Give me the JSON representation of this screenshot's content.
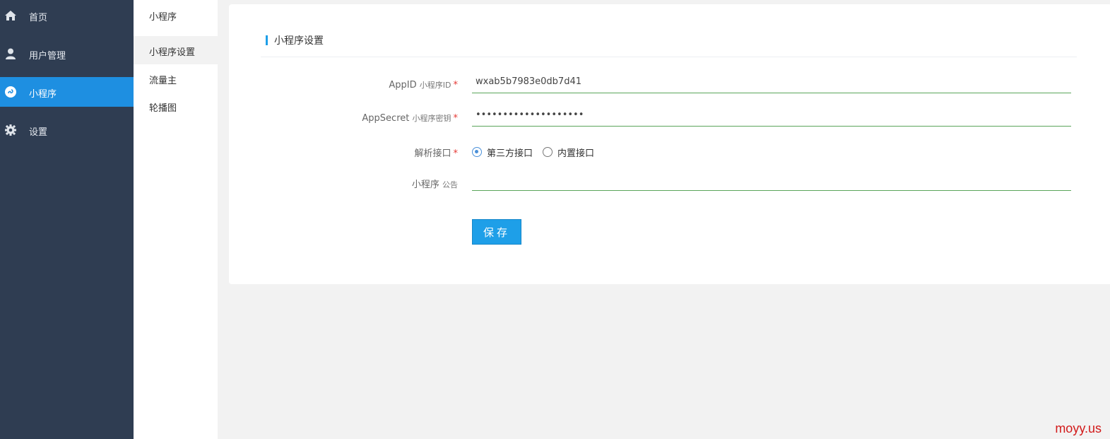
{
  "sidebar": {
    "items": [
      {
        "label": "首页",
        "icon": "home-icon"
      },
      {
        "label": "用户管理",
        "icon": "user-icon"
      },
      {
        "label": "小程序",
        "icon": "miniprogram-icon",
        "active": true
      },
      {
        "label": "设置",
        "icon": "gear-icon"
      }
    ],
    "active_color": "#1e8fe1",
    "background": "#2f3d52"
  },
  "submenu": {
    "title": "小程序",
    "items": [
      {
        "label": "小程序设置",
        "active": true
      },
      {
        "label": "流量主"
      },
      {
        "label": "轮播图"
      }
    ]
  },
  "card": {
    "title": "小程序设置",
    "fields": {
      "appid": {
        "label": "AppID",
        "label_small": "小程序ID",
        "required": "*",
        "value": "wxab5b7983e0db7d41"
      },
      "appsecret": {
        "label": "AppSecret",
        "label_small": "小程序密钥",
        "required": "*",
        "value": "••••••••••••••••••••"
      },
      "api": {
        "label": "解析接口",
        "required": "*",
        "options": [
          "第三方接口",
          "内置接口"
        ],
        "selected": "第三方接口"
      },
      "notice": {
        "label": "小程序",
        "label_small": "公告",
        "value": ""
      }
    },
    "save_label": "保存",
    "accent": "#1e9fe8"
  },
  "watermark": "moyy.us"
}
